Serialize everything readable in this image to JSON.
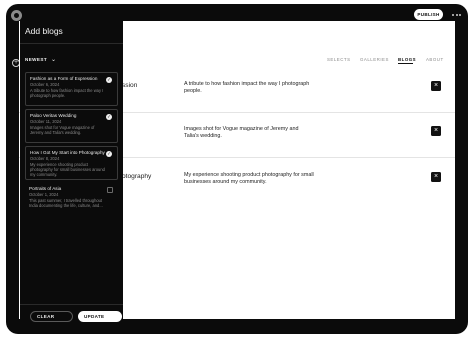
{
  "header": {
    "publish_label": "PUBLISH",
    "more_icon": "more-horizontal-icon",
    "logo_icon": "app-logo-icon"
  },
  "site_nav": {
    "items": [
      "SELECTS",
      "GALLERIES",
      "BLOGS",
      "ABOUT"
    ],
    "active": "BLOGS"
  },
  "blog_rows": [
    {
      "title_fragment": "ssion",
      "description": "A tribute to how fashion impact the way I photograph people."
    },
    {
      "title_fragment": "",
      "description": "Images shot for Vogue magazine of Jeremy and Talia's wedding."
    },
    {
      "title_fragment": "otography",
      "description": "My experience shooting product photography for small businesses around my community."
    }
  ],
  "panel": {
    "title": "Add blogs",
    "sort_label": "NEWEST",
    "cards": [
      {
        "title": "Fashion as a Form of Expression",
        "date": "October 6, 2024",
        "excerpt": "A tribute to how fashion impact the way I photograph people.",
        "selected": true
      },
      {
        "title": "Paloo Veritas Wedding",
        "date": "October 11, 2024",
        "excerpt": "Images shot for Vogue magazine of Jeremy and Talia's wedding.",
        "selected": true
      },
      {
        "title": "How I Got My Start into Photography",
        "date": "October 8, 2024",
        "excerpt": "My experience shooting product photography for small businesses around my community.",
        "selected": true
      },
      {
        "title": "Portraits of Asia",
        "date": "October 1, 2024",
        "excerpt": "This past summer, I travelled throughout India documenting the life, culture, and...",
        "selected": false
      }
    ],
    "clear_label": "CLEAR",
    "update_label": "UPDATE"
  },
  "colors": {
    "frame": "#0b0b0b",
    "canvas": "#ffffff",
    "accent": "#ffffff"
  }
}
